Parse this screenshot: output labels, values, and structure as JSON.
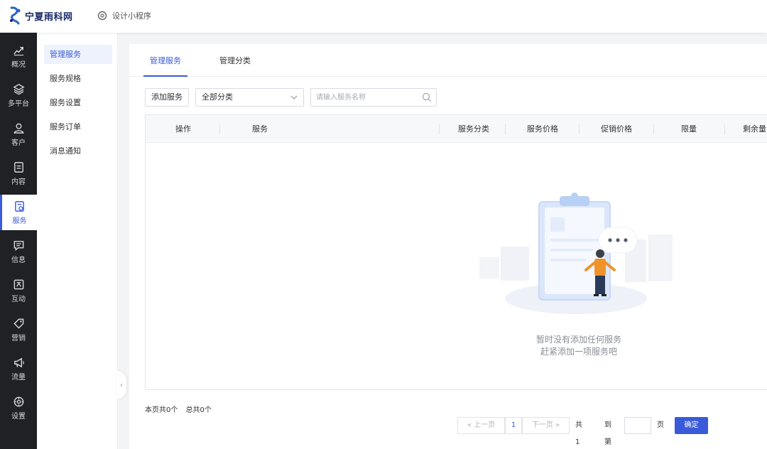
{
  "topbar": {
    "logo_text": "宁夏雨科网",
    "design_link": "设计小程序"
  },
  "leftnav": [
    {
      "label": "概况",
      "icon": "chart-icon"
    },
    {
      "label": "多平台",
      "icon": "layers-icon"
    },
    {
      "label": "客户",
      "icon": "user-icon"
    },
    {
      "label": "内容",
      "icon": "document-icon"
    },
    {
      "label": "服务",
      "icon": "service-icon",
      "active": true
    },
    {
      "label": "信息",
      "icon": "message-icon"
    },
    {
      "label": "互动",
      "icon": "interaction-icon"
    },
    {
      "label": "营销",
      "icon": "tag-icon"
    },
    {
      "label": "流量",
      "icon": "megaphone-icon"
    },
    {
      "label": "设置",
      "icon": "gear-icon"
    }
  ],
  "subnav": [
    {
      "label": "管理服务",
      "active": true
    },
    {
      "label": "服务规格"
    },
    {
      "label": "服务设置"
    },
    {
      "label": "服务订单"
    },
    {
      "label": "消息通知"
    }
  ],
  "tabs": [
    {
      "label": "管理服务",
      "active": true
    },
    {
      "label": "管理分类"
    }
  ],
  "toolbar": {
    "add_label": "添加服务",
    "category_select": "全部分类",
    "search_placeholder": "请输入服务名称"
  },
  "table": {
    "columns": [
      "操作",
      "服务",
      "服务分类",
      "服务价格",
      "促销价格",
      "限量",
      "剩余量"
    ],
    "empty_line1": "暂时没有添加任何服务",
    "empty_line2": "赶紧添加一项服务吧"
  },
  "footer": {
    "page_count": "本页共0个",
    "total_count": "总共0个"
  },
  "pagination": {
    "prev": "上一页",
    "current": "1",
    "next": "下一页",
    "total_pages": "共1页",
    "goto_label": "到第",
    "page_unit": "页",
    "confirm": "确定"
  },
  "colors": {
    "accent": "#3a5bd9",
    "nav_bg": "#1f2125",
    "page_bg": "#f3f4f6"
  }
}
